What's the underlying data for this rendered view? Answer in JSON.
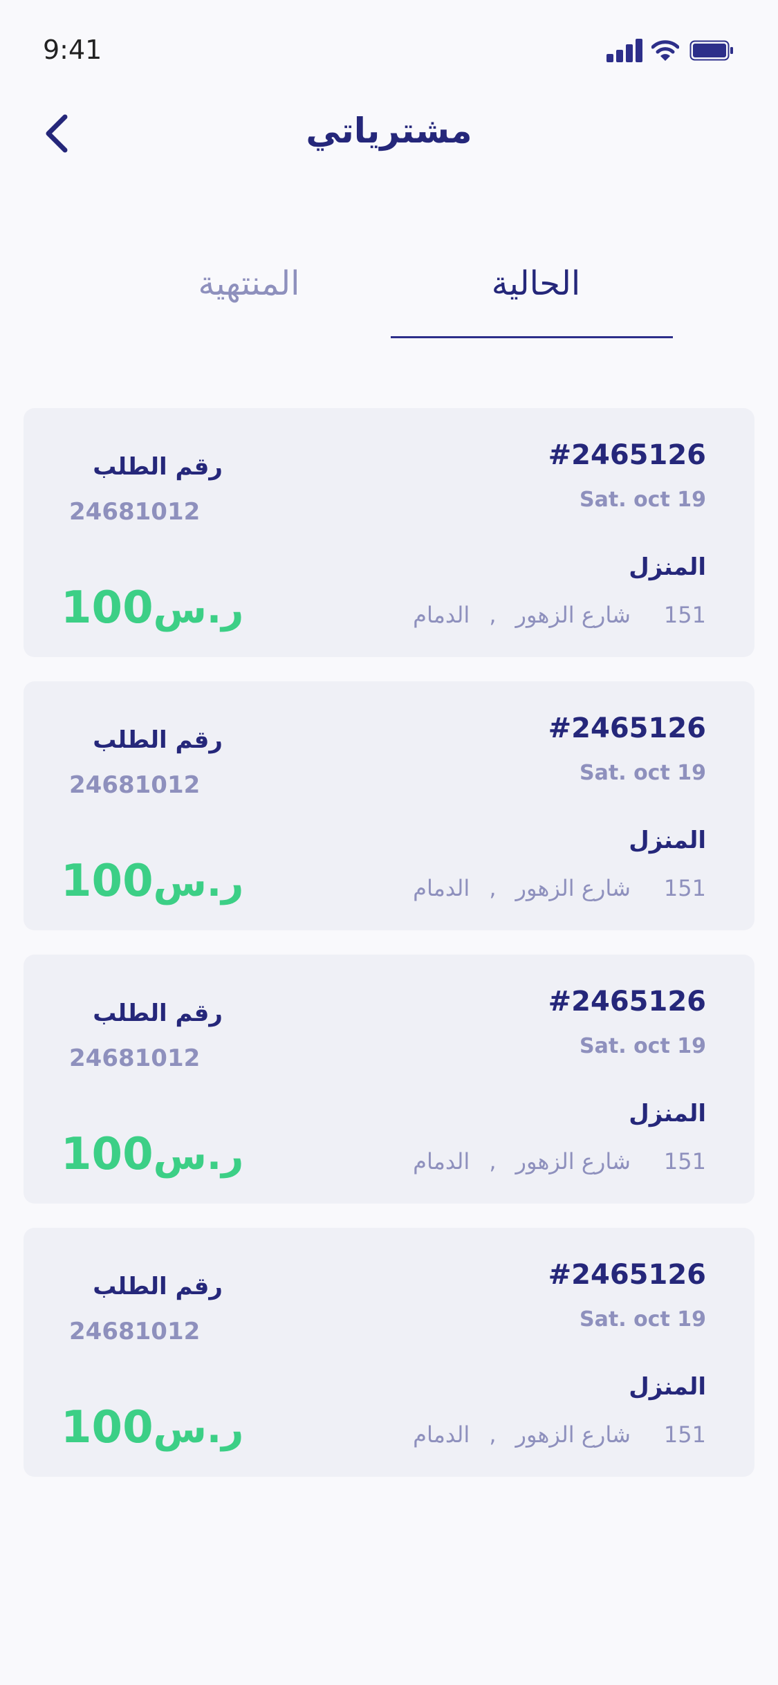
{
  "status_bar": {
    "time": "9:41"
  },
  "header": {
    "title": "مشترياتي"
  },
  "tabs": [
    {
      "label": "الحالية",
      "active": true
    },
    {
      "label": "المنتهية",
      "active": false
    }
  ],
  "orders": [
    {
      "id": "#2465126",
      "date": "Sat. oct  19",
      "address_title": "المنزل",
      "address_number": "151",
      "address_street": "شارع الزهور",
      "address_separator": ",",
      "address_city": "الدمام",
      "request_label": "رقم الطلب",
      "request_number": "24681012",
      "price": "100",
      "currency": "ر.س"
    },
    {
      "id": "#2465126",
      "date": "Sat. oct  19",
      "address_title": "المنزل",
      "address_number": "151",
      "address_street": "شارع الزهور",
      "address_separator": ",",
      "address_city": "الدمام",
      "request_label": "رقم الطلب",
      "request_number": "24681012",
      "price": "100",
      "currency": "ر.س"
    },
    {
      "id": "#2465126",
      "date": "Sat. oct  19",
      "address_title": "المنزل",
      "address_number": "151",
      "address_street": "شارع الزهور",
      "address_separator": ",",
      "address_city": "الدمام",
      "request_label": "رقم الطلب",
      "request_number": "24681012",
      "price": "100",
      "currency": "ر.س"
    },
    {
      "id": "#2465126",
      "date": "Sat. oct  19",
      "address_title": "المنزل",
      "address_number": "151",
      "address_street": "شارع الزهور",
      "address_separator": ",",
      "address_city": "الدمام",
      "request_label": "رقم الطلب",
      "request_number": "24681012",
      "price": "100",
      "currency": "ر.س"
    }
  ],
  "colors": {
    "primary": "#25277a",
    "muted": "#8e90bd",
    "price": "#3ccf86",
    "card": "#eff0f6",
    "background": "#f9f9fc"
  },
  "icons": {
    "back": "chevron-left-icon",
    "signal": "signal-icon",
    "wifi": "wifi-icon",
    "battery": "battery-icon"
  }
}
